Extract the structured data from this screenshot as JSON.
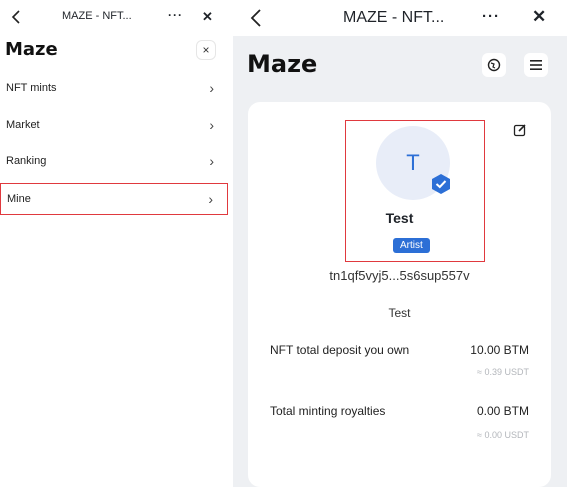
{
  "left": {
    "topbar": {
      "back_icon": "chevron-left-icon",
      "title": "MAZE - NFT...",
      "more_label": "···",
      "close_label": "✕"
    },
    "logo": "Maze",
    "menu_close_label": "×",
    "menu": [
      {
        "label": "NFT mints"
      },
      {
        "label": "Market"
      },
      {
        "label": "Ranking"
      },
      {
        "label": "Mine"
      }
    ],
    "chevron": "›"
  },
  "right": {
    "topbar": {
      "back_icon": "chevron-left-icon",
      "title": "MAZE - NFT...",
      "more_label": "···",
      "close_label": "✕"
    },
    "logo": "Maze",
    "profile": {
      "avatar_letter": "T",
      "name": "Test",
      "badge": "Artist",
      "address": "tn1qf5vyj5...5s6sup557v",
      "bio": "Test",
      "stats": [
        {
          "label": "NFT total deposit you own",
          "value": "10.00 BTM",
          "sub": "≈ 0.39 USDT"
        },
        {
          "label": "Total minting royalties",
          "value": "0.00 BTM",
          "sub": "≈ 0.00 USDT"
        }
      ]
    }
  },
  "colors": {
    "accent": "#2c6fd6",
    "highlight_border": "#e0393e",
    "right_background": "#eef0f3"
  }
}
